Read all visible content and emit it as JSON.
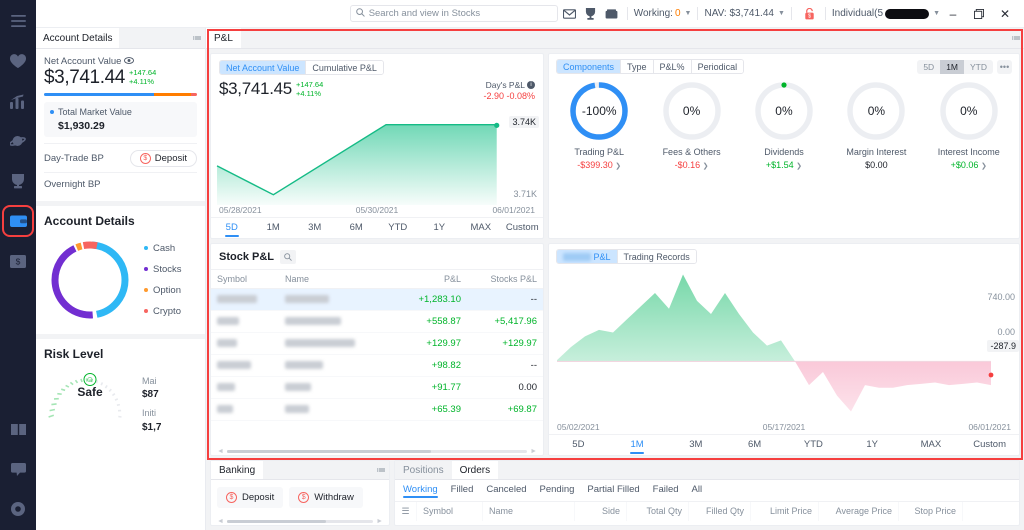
{
  "topbar": {
    "search_placeholder": "Search and view in Stocks",
    "icons": [
      "mail-icon",
      "trophy-icon",
      "inbox-icon"
    ],
    "working_label": "Working:",
    "working_value": "0",
    "nav_label": "NAV: $3,741.44",
    "lock_icon": "lock-icon",
    "account_label": "Individual(5",
    "account_redacted": true,
    "minimize": "–",
    "maximize": "❐",
    "close": "✕"
  },
  "rail": {
    "items": [
      {
        "name": "menu-icon",
        "active": false,
        "highlight": false
      },
      {
        "name": "heart-icon",
        "active": false,
        "highlight": false
      },
      {
        "name": "chart-icon",
        "active": false,
        "highlight": false
      },
      {
        "name": "planet-icon",
        "active": false,
        "highlight": false
      },
      {
        "name": "trophy-icon",
        "active": false,
        "highlight": false
      },
      {
        "name": "wallet-icon",
        "active": true,
        "highlight": true
      },
      {
        "name": "dollar-bill-icon",
        "active": false,
        "highlight": false
      }
    ],
    "bottom_items": [
      {
        "name": "book-icon"
      },
      {
        "name": "chat-icon"
      },
      {
        "name": "settings-icon"
      }
    ]
  },
  "left_panel": {
    "tab": "Account Details",
    "menu_icon": "list-menu-icon",
    "net_account_value_label": "Net Account Value",
    "eye_icon": "eye-icon",
    "net_account_value": "$3,741.44",
    "delta_amount": "+147.64",
    "delta_percent": "+4.11%",
    "alloc_bar": [
      {
        "name": "cash",
        "color": "#2f8ff5",
        "pct": 72
      },
      {
        "name": "stocks",
        "color": "#ff7d00",
        "pct": 24
      },
      {
        "name": "other",
        "color": "#f76560",
        "pct": 4
      }
    ],
    "total_market_value_label": "Total Market Value",
    "total_market_value": "$1,930.29",
    "total_market_value_dot": "#2f8ff5",
    "day_trade_bp_label": "Day-Trade BP",
    "deposit_label": "Deposit",
    "deposit_icon": "dollar-circle-icon",
    "overnight_bp_label": "Overnight BP",
    "account_details_heading": "Account Details",
    "donut_legend": [
      {
        "label": "Cash",
        "color": "#2fb8f5"
      },
      {
        "label": "Stocks",
        "color": "#722ed1"
      },
      {
        "label": "Option",
        "color": "#ff9a2e"
      },
      {
        "label": "Crypto",
        "color": "#f76560"
      }
    ],
    "donut_values": [
      46,
      44,
      2,
      8
    ],
    "risk_level_heading": "Risk Level",
    "risk_status": "Safe",
    "risk_face_icon": "smiley-icon",
    "risk_fig_1_label": "Mai",
    "risk_fig_1_value": "$87",
    "risk_fig_2_label": "Initi",
    "risk_fig_2_value": "$1,7"
  },
  "workspace": {
    "tab": "P&L",
    "menu_icon": "list-menu-icon",
    "nav_card": {
      "segments": [
        {
          "label": "Net Account Value",
          "on": true
        },
        {
          "label": "Cumulative P&L",
          "on": false
        }
      ],
      "value": "$3,741.45",
      "delta_amount": "+147.64",
      "delta_percent": "+4.11%",
      "days_pl_label": "Day's P&L",
      "days_pl_info_icon": "info-icon",
      "days_pl_value": "-2.90 -0.08%",
      "axis_dates": [
        "05/28/2021",
        "05/30/2021",
        "06/01/2021"
      ],
      "label_high": "3.74K",
      "label_low": "3.71K",
      "ranges": [
        {
          "label": "5D",
          "on": true
        },
        {
          "label": "1M",
          "on": false
        },
        {
          "label": "3M",
          "on": false
        },
        {
          "label": "6M",
          "on": false
        },
        {
          "label": "YTD",
          "on": false
        },
        {
          "label": "1Y",
          "on": false
        },
        {
          "label": "MAX",
          "on": false
        },
        {
          "label": "Custom",
          "on": false
        }
      ]
    },
    "components_card": {
      "segments": [
        {
          "label": "Components",
          "on": true
        },
        {
          "label": "Type",
          "on": false
        },
        {
          "label": "P&L%",
          "on": false
        },
        {
          "label": "Periodical",
          "on": false
        }
      ],
      "ranges": [
        {
          "label": "5D",
          "on": false
        },
        {
          "label": "1M",
          "on": true
        },
        {
          "label": "YTD",
          "on": false
        }
      ],
      "more_icon": "ellipsis-icon",
      "donuts": [
        {
          "pct": "-100%",
          "name": "Trading P&L",
          "amount": "-$399.30",
          "sign": "neg",
          "ring_pct": 100,
          "ring_color": "#2f8ff5",
          "dot": false,
          "chevron": true
        },
        {
          "pct": "0%",
          "name": "Fees & Others",
          "amount": "-$0.16",
          "sign": "neg",
          "ring_pct": 0,
          "ring_color": "#2f8ff5",
          "dot": false,
          "chevron": true
        },
        {
          "pct": "0%",
          "name": "Dividends",
          "amount": "+$1.54",
          "sign": "pos",
          "ring_pct": 0,
          "ring_color": "#00b42a",
          "dot": true,
          "chevron": true
        },
        {
          "pct": "0%",
          "name": "Margin Interest",
          "amount": "$0.00",
          "sign": "neu",
          "ring_pct": 0,
          "ring_color": "#2f8ff5",
          "dot": false,
          "chevron": false
        },
        {
          "pct": "0%",
          "name": "Interest Income",
          "amount": "+$0.06",
          "sign": "pos",
          "ring_pct": 0,
          "ring_color": "#00b42a",
          "dot": false,
          "chevron": true
        }
      ]
    },
    "stock_pl_card": {
      "title": "Stock P&L",
      "search_icon": "search-icon",
      "columns": [
        "Symbol",
        "Name",
        "P&L",
        "Stocks P&L"
      ],
      "rows": [
        {
          "symbol": "",
          "name": "",
          "pl": "+1,283.10",
          "stocks_pl": "--",
          "selected": true
        },
        {
          "symbol": "",
          "name": "",
          "pl": "+558.87",
          "stocks_pl": "+5,417.96",
          "selected": false
        },
        {
          "symbol": "",
          "name": "",
          "pl": "+129.97",
          "stocks_pl": "+129.97",
          "selected": false
        },
        {
          "symbol": "",
          "name": "",
          "pl": "+98.82",
          "stocks_pl": "--",
          "selected": false
        },
        {
          "symbol": "",
          "name": "",
          "pl": "+91.77",
          "stocks_pl": "0.00",
          "selected": false
        },
        {
          "symbol": "",
          "name": "",
          "pl": "+65.39",
          "stocks_pl": "+69.87",
          "selected": false
        }
      ]
    },
    "history_card": {
      "segments": [
        {
          "label": "P&L",
          "on": true,
          "redacted_prefix": true
        },
        {
          "label": "Trading Records",
          "on": false
        }
      ],
      "axis_dates": [
        "05/02/2021",
        "05/17/2021",
        "06/01/2021"
      ],
      "label_high": "740.00",
      "label_zero": "0.00",
      "label_current": "-287.9",
      "ranges": [
        {
          "label": "5D",
          "on": false
        },
        {
          "label": "1M",
          "on": true
        },
        {
          "label": "3M",
          "on": false
        },
        {
          "label": "6M",
          "on": false
        },
        {
          "label": "YTD",
          "on": false
        },
        {
          "label": "1Y",
          "on": false
        },
        {
          "label": "MAX",
          "on": false
        },
        {
          "label": "Custom",
          "on": false
        }
      ]
    }
  },
  "bottom": {
    "banking": {
      "tab": "Banking",
      "menu_icon": "list-menu-icon",
      "actions": [
        {
          "label": "Deposit",
          "icon": "dollar-circle-icon"
        },
        {
          "label": "Withdraw",
          "icon": "dollar-circle-icon"
        }
      ]
    },
    "orders": {
      "tabs": [
        {
          "label": "Positions",
          "on": false
        },
        {
          "label": "Orders",
          "on": true
        }
      ],
      "subtabs": [
        {
          "label": "Working",
          "on": true
        },
        {
          "label": "Filled",
          "on": false
        },
        {
          "label": "Canceled",
          "on": false
        },
        {
          "label": "Pending",
          "on": false
        },
        {
          "label": "Partial Filled",
          "on": false
        },
        {
          "label": "Failed",
          "on": false
        },
        {
          "label": "All",
          "on": false
        }
      ],
      "menu_icon": "list-menu-icon",
      "columns": [
        "Symbol",
        "Name",
        "Side",
        "Total Qty",
        "Filled Qty",
        "Limit Price",
        "Average Price",
        "Stop Price"
      ]
    }
  },
  "chart_data": [
    {
      "type": "area",
      "title": "Net Account Value",
      "id": "nav-5d",
      "x": [
        "05/28/2021",
        "05/29/2021",
        "05/30/2021",
        "05/31/2021",
        "06/01/2021"
      ],
      "values": [
        3722,
        3712,
        3725,
        3741.45,
        3741.45
      ],
      "ylim": [
        3710,
        3742
      ],
      "ylabel": "",
      "xlabel": "",
      "grid": false,
      "legend": "none",
      "annotations": [
        "3.74K",
        "3.71K"
      ],
      "line_color": "#00b42a",
      "series": [
        {
          "name": "Net Account Value",
          "values": [
            3722,
            3712,
            3725,
            3741.45,
            3741.45
          ]
        }
      ]
    },
    {
      "type": "pie",
      "title": "Components",
      "id": "components-donuts",
      "categories": [
        "Trading P&L",
        "Fees & Others",
        "Dividends",
        "Margin Interest",
        "Interest Income"
      ],
      "values": [
        -399.3,
        -0.16,
        1.54,
        0.0,
        0.06
      ],
      "percent_labels": [
        "-100%",
        "0%",
        "0%",
        "0%",
        "0%"
      ],
      "legend": "below"
    },
    {
      "type": "pie",
      "title": "Account Allocation",
      "id": "allocation-donut",
      "categories": [
        "Cash",
        "Stocks",
        "Option",
        "Crypto"
      ],
      "values": [
        46,
        44,
        2,
        8
      ],
      "colors": [
        "#2fb8f5",
        "#722ed1",
        "#ff9a2e",
        "#f76560"
      ],
      "legend": "right"
    },
    {
      "type": "area",
      "title": "P&L",
      "id": "pl-1m",
      "x": [
        "05/02/2021",
        "05/17/2021",
        "06/01/2021"
      ],
      "xlabel": "",
      "ylabel": "",
      "ylim": [
        -420,
        800
      ],
      "yticks": [
        740.0,
        0.0
      ],
      "grid": false,
      "legend": "none",
      "annotations": [
        "740.00",
        "0.00",
        "-287.9"
      ],
      "series": [
        {
          "name": "P&L",
          "values": [
            20,
            120,
            200,
            250,
            240,
            320,
            420,
            560,
            440,
            740,
            520,
            420,
            560,
            420,
            300,
            210,
            250,
            60,
            -110,
            -40,
            -150,
            -220,
            -330,
            -180,
            -200,
            -210,
            -230,
            -250,
            -270,
            -287.9
          ]
        }
      ]
    }
  ]
}
